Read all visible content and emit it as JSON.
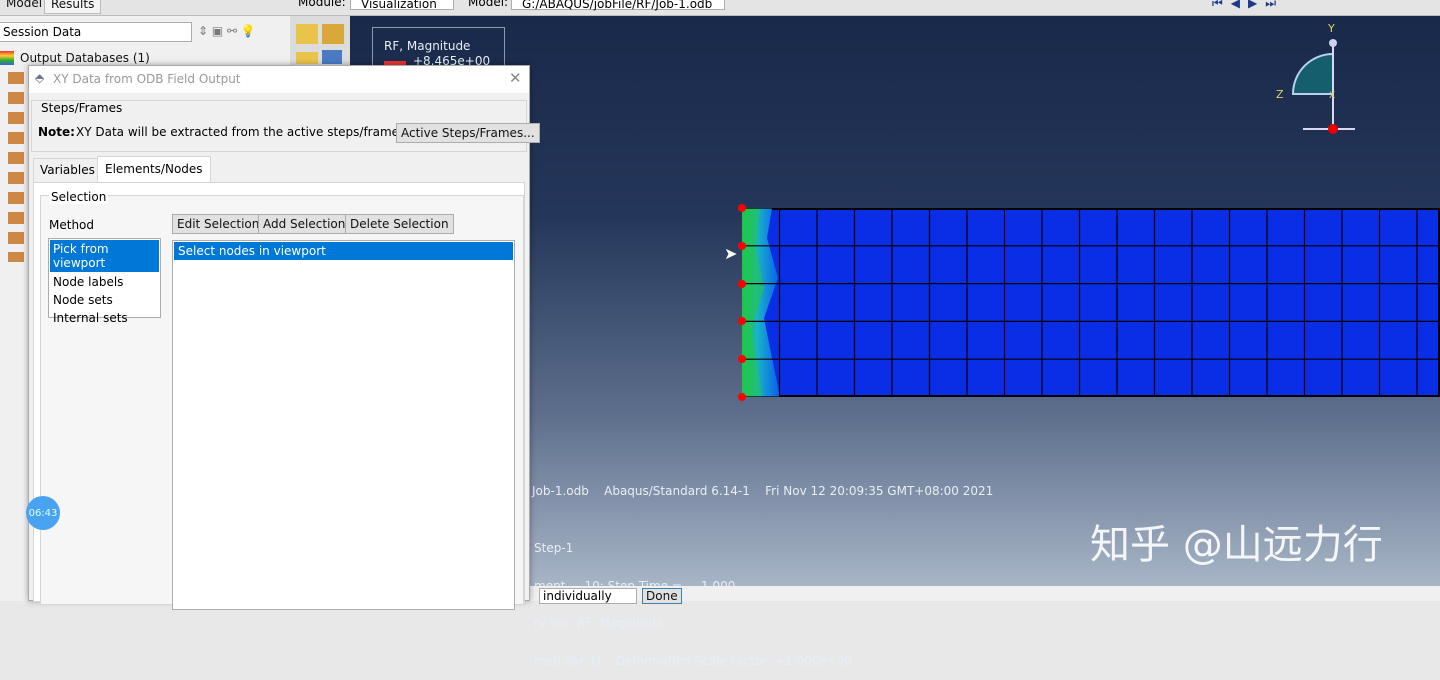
{
  "top": {
    "tabs": [
      "Model",
      "Results"
    ],
    "module_label": "Module:",
    "module_value": "Visualization",
    "model_label": "Model:",
    "model_value": "G:/ABAQUS/jobFile/RF/Job-1.odb"
  },
  "tree": {
    "dropdown": "Session Data",
    "items": [
      "Output Databases (1)"
    ]
  },
  "legend": {
    "title": "RF, Magnitude",
    "max": "+8.465e+00"
  },
  "dialog": {
    "title": "XY Data from ODB Field Output",
    "group_steps": "Steps/Frames",
    "note_bold": "Note:",
    "note": "XY Data will be extracted from the active steps/frames",
    "active_btn": "Active Steps/Frames...",
    "tabs": [
      "Variables",
      "Elements/Nodes"
    ],
    "group_selection": "Selection",
    "method_label": "Method",
    "methods": [
      "Pick from viewport",
      "Node labels",
      "Node sets",
      "Internal sets"
    ],
    "buttons": [
      "Edit Selection",
      "Add Selection",
      "Delete Selection"
    ],
    "selection_items": [
      "Select nodes in viewport"
    ]
  },
  "viewport_info": {
    "line1": "Job-1.odb    Abaqus/Standard 6.14-1    Fri Nov 12 20:09:35 GMT+08:00 2021",
    "line2": "Step-1",
    "line3": "ment     10: Step Time =     1.000",
    "line4": "ry Var: RF, Magnitude",
    "line5": "med Var: U    Deformation Scale Factor: +1.000e+00"
  },
  "triad": {
    "y": "Y",
    "z": "Z",
    "x": "X"
  },
  "prompt": {
    "select_value": "individually",
    "done": "Done"
  },
  "timer": "06:43",
  "watermark": "知乎 @山远力行"
}
